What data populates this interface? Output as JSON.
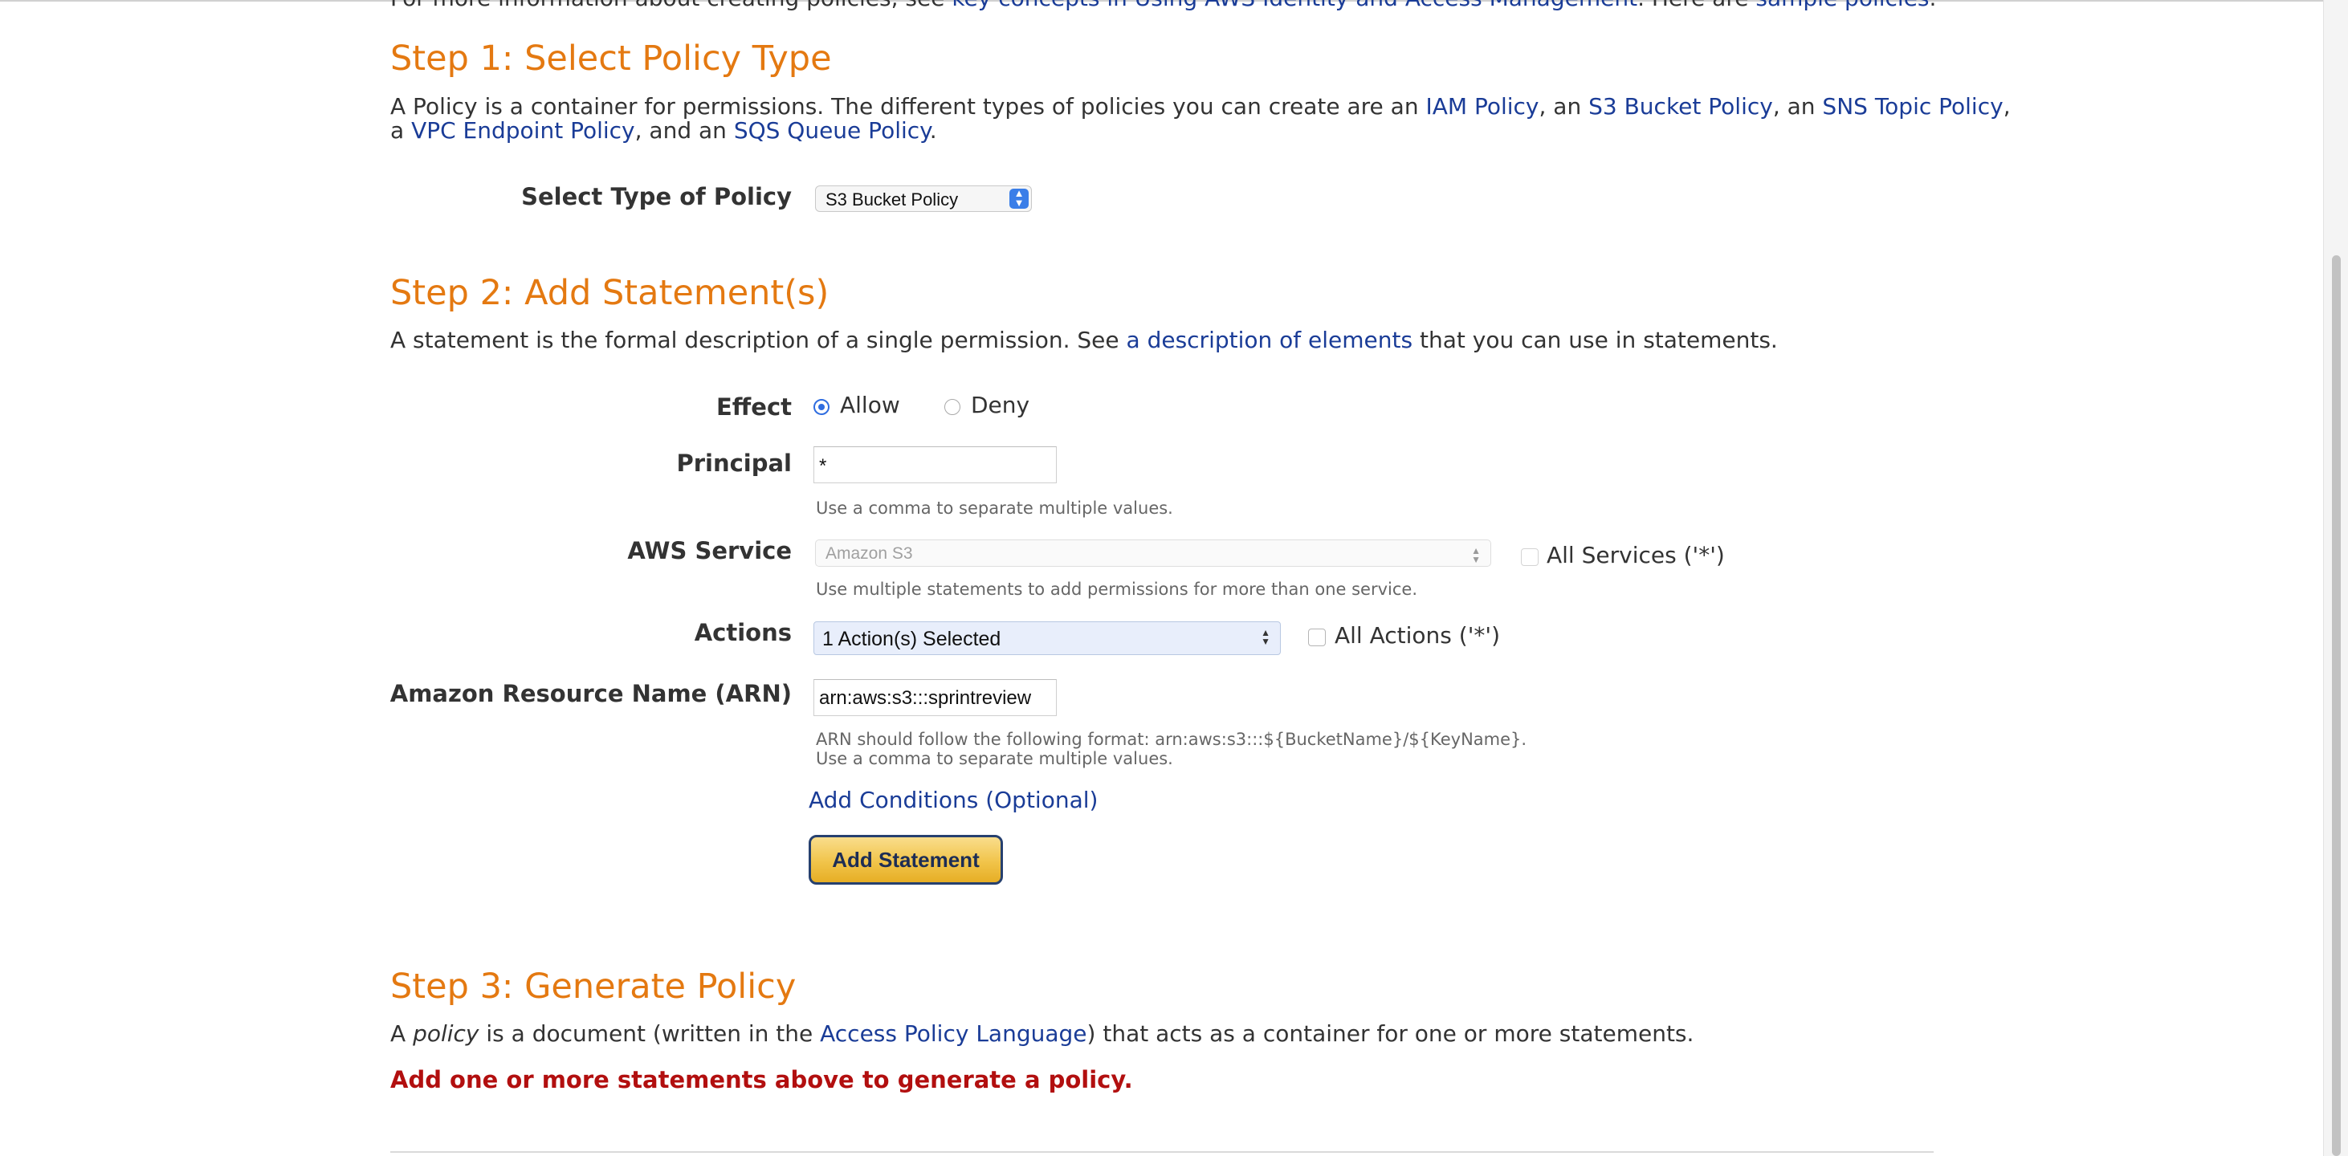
{
  "intro": {
    "prefix": "For more information about creating policies, see ",
    "link1": "key concepts in Using AWS Identity and Access Management",
    "middle": ". Here are ",
    "link2": "sample policies",
    "suffix": "."
  },
  "step1": {
    "title": "Step 1: Select Policy Type",
    "desc_1": "A Policy is a container for permissions. The different types of policies you can create are an ",
    "link_iam": "IAM Policy",
    "sep_1": ", an ",
    "link_s3": "S3 Bucket Policy",
    "sep_2": ", an ",
    "link_sns": "SNS Topic Policy",
    "sep_3": ",",
    "desc_2": "a ",
    "link_vpc": "VPC Endpoint Policy",
    "sep_4": ", and an ",
    "link_sqs": "SQS Queue Policy",
    "end": ".",
    "select_label": "Select Type of Policy",
    "select_value": "S3 Bucket Policy"
  },
  "step2": {
    "title": "Step 2: Add Statement(s)",
    "desc_prefix": "A statement is the formal description of a single permission. See ",
    "desc_link": "a description of elements",
    "desc_suffix": " that you can use in statements.",
    "effect_label": "Effect",
    "effect_allow": "Allow",
    "effect_deny": "Deny",
    "principal_label": "Principal",
    "principal_value": "*",
    "principal_hint": "Use a comma to separate multiple values.",
    "service_label": "AWS Service",
    "service_value": "Amazon S3",
    "all_services": "All Services ('*')",
    "service_hint": "Use multiple statements to add permissions for more than one service.",
    "actions_label": "Actions",
    "actions_value": "1 Action(s) Selected",
    "all_actions": "All Actions ('*')",
    "arn_label": "Amazon Resource Name (ARN)",
    "arn_value": "arn:aws:s3:::sprintreview",
    "arn_hint_1": "ARN should follow the following format: arn:aws:s3:::${BucketName}/${KeyName}.",
    "arn_hint_2": "Use a comma to separate multiple values.",
    "conditions_link": "Add Conditions (Optional)",
    "add_button": "Add Statement"
  },
  "step3": {
    "title": "Step 3: Generate Policy",
    "desc_a": "A ",
    "desc_em": "policy",
    "desc_mid": " is a document (written in the ",
    "desc_link": "Access Policy Language",
    "desc_end": ") that acts as a container for one or more statements.",
    "error": "Add one or more statements above to generate a policy."
  },
  "colors": {
    "step_title": "#e47911",
    "link": "#1a3c97",
    "error": "#b20f0f",
    "button": "#f1c44a"
  }
}
